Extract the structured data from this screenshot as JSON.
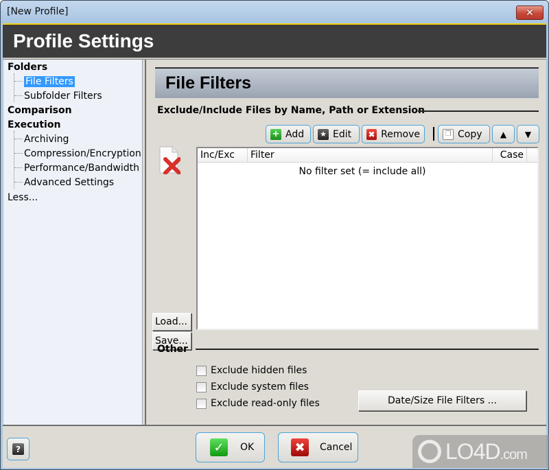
{
  "window": {
    "title": "[New Profile]",
    "close_icon": "close-x-icon"
  },
  "header": {
    "title": "Profile Settings"
  },
  "sidebar": {
    "groups": [
      {
        "label": "Folders",
        "children": [
          "File Filters",
          "Subfolder Filters"
        ]
      },
      {
        "label": "Comparison",
        "children": []
      },
      {
        "label": "Execution",
        "children": [
          "Archiving",
          "Compression/Encryption",
          "Performance/Bandwidth",
          "Advanced Settings"
        ]
      }
    ],
    "selected": "File Filters",
    "less_link": "Less..."
  },
  "main": {
    "section_title": "File Filters",
    "filter_group_label": "Exclude/Include Files by Name, Path or Extension",
    "toolbar": {
      "add": "Add",
      "edit": "Edit",
      "remove": "Remove",
      "copy": "Copy",
      "move_up_icon": "arrow-up-icon",
      "move_down_icon": "arrow-down-icon"
    },
    "load_button": "Load...",
    "save_button": "Save...",
    "list": {
      "columns": [
        "Inc/Exc",
        "Filter",
        "Case"
      ],
      "empty_text": "No filter set (= include all)",
      "rows": []
    },
    "other_group_label": "Other",
    "checkboxes": [
      {
        "label": "Exclude hidden files",
        "checked": false
      },
      {
        "label": "Exclude system files",
        "checked": false
      },
      {
        "label": "Exclude read-only files",
        "checked": false
      }
    ],
    "date_size_button": "Date/Size File Filters ..."
  },
  "footer": {
    "help_icon": "?",
    "ok": "OK",
    "cancel": "Cancel"
  },
  "watermark": {
    "text": "LO4D",
    "suffix": ".com"
  },
  "colors": {
    "header_bg": "#3d3d3d",
    "accent_line": "#f2d40d",
    "selection": "#3399ff",
    "button_border": "#4aa3d8"
  }
}
